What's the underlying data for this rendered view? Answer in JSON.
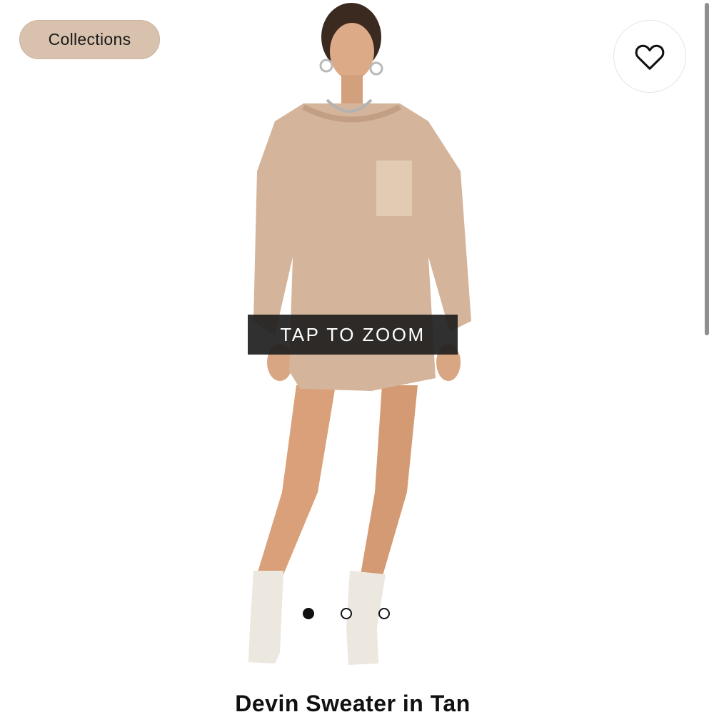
{
  "header": {
    "collections_label": "Collections"
  },
  "product": {
    "zoom_label": "TAP TO ZOOM",
    "title": "Devin Sweater in Tan",
    "image_count": 3,
    "active_image_index": 0
  },
  "icons": {
    "favorite": "heart-outline-icon"
  },
  "colors": {
    "pill_background": "#d8c1ad",
    "sweater": "#d4b49a",
    "boots": "#ece7df",
    "zoom_overlay": "#1e1e1e"
  }
}
